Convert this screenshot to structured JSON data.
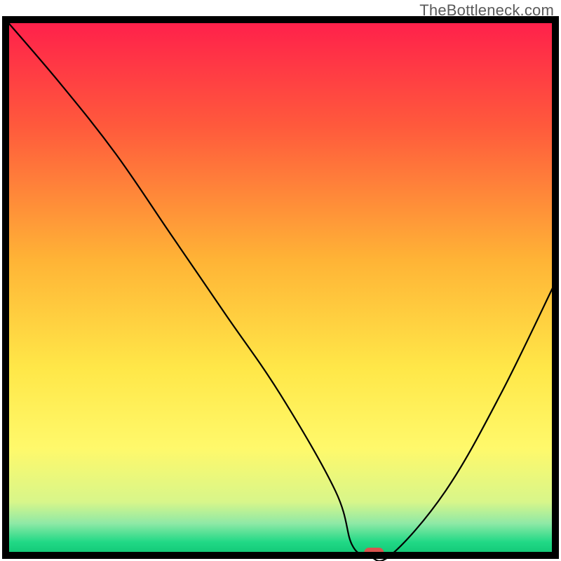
{
  "watermark": "TheBottleneck.com",
  "chart_data": {
    "type": "line",
    "title": "",
    "xlabel": "",
    "ylabel": "",
    "xlim": [
      0,
      100
    ],
    "ylim": [
      0,
      100
    ],
    "x": [
      0,
      10,
      20,
      30,
      40,
      50,
      60,
      63,
      66,
      70,
      80,
      90,
      100
    ],
    "values": [
      100,
      88,
      75,
      60,
      45,
      30,
      12,
      2,
      0,
      0,
      12,
      30,
      51
    ],
    "marker": {
      "x": 67,
      "y": 0,
      "color": "#d9534f",
      "shape": "capsule"
    },
    "background_gradient": [
      {
        "pos": 0.0,
        "color": "#ff1f4b"
      },
      {
        "pos": 0.2,
        "color": "#ff5a3c"
      },
      {
        "pos": 0.45,
        "color": "#ffb436"
      },
      {
        "pos": 0.65,
        "color": "#ffe748"
      },
      {
        "pos": 0.8,
        "color": "#fff96b"
      },
      {
        "pos": 0.9,
        "color": "#d8f68a"
      },
      {
        "pos": 0.94,
        "color": "#8fe9a6"
      },
      {
        "pos": 0.975,
        "color": "#21d986"
      },
      {
        "pos": 1.0,
        "color": "#10c574"
      }
    ],
    "frame_color": "#000000",
    "line_color": "#000000",
    "line_width": 2.2
  }
}
